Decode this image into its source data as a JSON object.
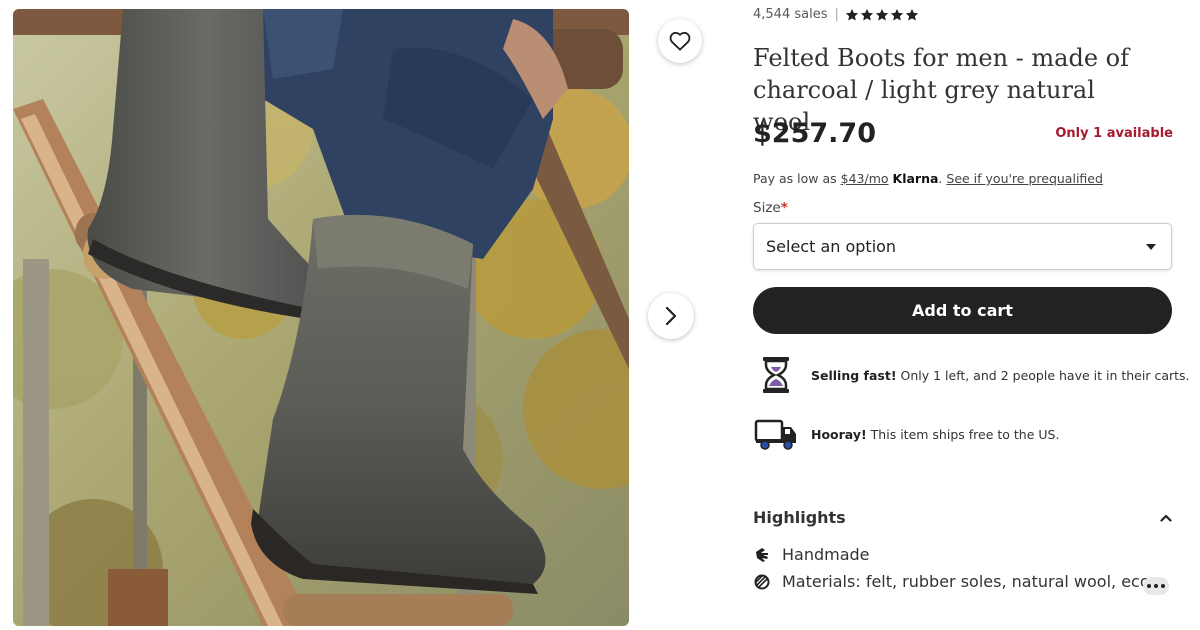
{
  "colors": {
    "accent_dark": "#222222",
    "stock_red": "#a61a2e",
    "required_red": "#c0362c",
    "hourglass_purple": "#7c5aa6",
    "truck_blue": "#2b4ea8"
  },
  "listing": {
    "sales": "4,544 sales",
    "rating_stars": 5,
    "title": "Felted Boots for men - made of charcoal / light grey natural wool",
    "price": "$257.70",
    "stock": "Only 1 available"
  },
  "klarna": {
    "prefix": "Pay as low as ",
    "amount": "$43/mo",
    "brand": "Klarna",
    "period": ".",
    "link": "See if you're prequalified"
  },
  "size": {
    "label": "Size",
    "required_mark": "*",
    "selected": "Select an option"
  },
  "add_to_cart": "Add to cart",
  "notices": {
    "selling_fast": {
      "icon": "hourglass-icon",
      "bold": "Selling fast!",
      "text": " Only 1 left, and 2 people have it in their carts."
    },
    "shipping": {
      "icon": "delivery-truck-icon",
      "bold": "Hooray!",
      "text": " This item ships free to the US."
    }
  },
  "highlights": {
    "title": "Highlights",
    "items": [
      {
        "icon": "hand-icon",
        "text": "Handmade"
      },
      {
        "icon": "materials-icon",
        "text": "Materials: felt, rubber soles, natural wool, eco ..."
      }
    ]
  },
  "icons": {
    "favorite": "heart-icon",
    "next": "chevron-right-icon",
    "dropdown": "caret-down-icon",
    "collapse": "chevron-up-icon",
    "more": "more-dots-icon"
  }
}
